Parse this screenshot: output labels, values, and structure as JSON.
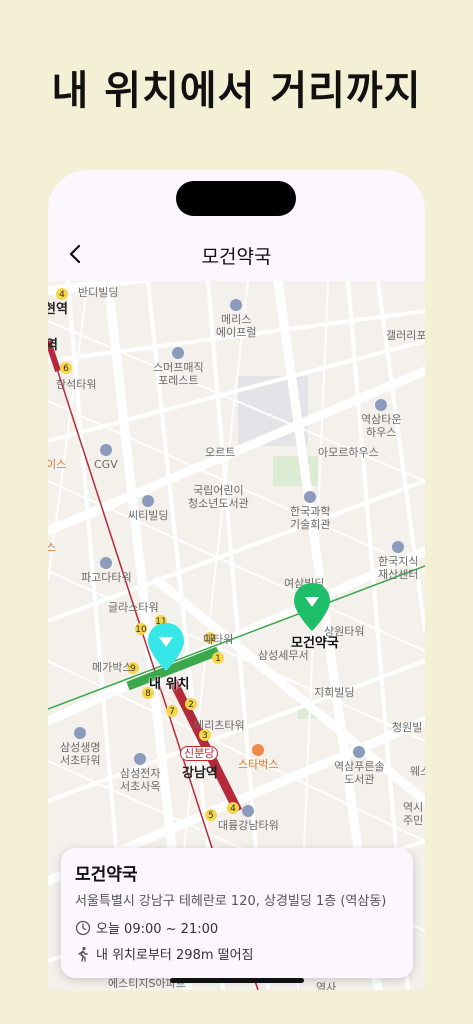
{
  "headline": "내 위치에서 거리까지",
  "nav": {
    "title": "모건약국",
    "back_icon": "chevron-left-icon"
  },
  "map": {
    "pois": [
      {
        "name": "반디빌딩"
      },
      {
        "name": "메리스\n에이프럴"
      },
      {
        "name": "갤러리포"
      },
      {
        "name": "현역"
      },
      {
        "name": "역"
      },
      {
        "name": "한석타워"
      },
      {
        "name": "스머프매직\n포레스트"
      },
      {
        "name": "역삼타운\n하우스"
      },
      {
        "name": "CGV"
      },
      {
        "name": "이스"
      },
      {
        "name": "오르트"
      },
      {
        "name": "아모르하우스"
      },
      {
        "name": "국립어린이\n청소년도서관"
      },
      {
        "name": "씨티빌딩"
      },
      {
        "name": "한국과학\n기술회관"
      },
      {
        "name": "스"
      },
      {
        "name": "파고다타워"
      },
      {
        "name": "한국지식\n재산센터"
      },
      {
        "name": "여삼빌딩"
      },
      {
        "name": "글라스타워"
      },
      {
        "name": "상원타워"
      },
      {
        "name": "메가박스"
      },
      {
        "name": "매타워"
      },
      {
        "name": "삼성세무서"
      },
      {
        "name": "지희빌딩"
      },
      {
        "name": "메리츠타워"
      },
      {
        "name": "삼성생명\n서초타워"
      },
      {
        "name": "신분당"
      },
      {
        "name": "스타벅스"
      },
      {
        "name": "청원빌"
      },
      {
        "name": "삼성전자\n서초사옥"
      },
      {
        "name": "강남역"
      },
      {
        "name": "역삼푸른솔\n도서관"
      },
      {
        "name": "웨스"
      },
      {
        "name": "대륭강남타워"
      },
      {
        "name": "역시\n주민"
      },
      {
        "name": "에스티지S아파트"
      },
      {
        "name": "역사"
      }
    ],
    "my_location_label": "내 위치",
    "destination_label": "모건약국",
    "station_numbers": [
      "4",
      "6",
      "10",
      "11",
      "12",
      "9",
      "8",
      "7",
      "2",
      "3",
      "1",
      "5",
      "4"
    ]
  },
  "card": {
    "title": "모건약국",
    "address": "서울특별시 강남구 테헤란로 120, 상경빌딩 1층 (역삼동)",
    "hours": "오늘 09:00 ~ 21:00",
    "distance": "내 위치로부터 298m 떨어짐",
    "clock_icon": "clock-icon",
    "walk_icon": "walking-person-icon"
  },
  "colors": {
    "background": "#f3f0d6",
    "my_location_pin": "#37e6e6",
    "destination_pin": "#1fbe6a",
    "line_green": "#3aa84b",
    "line_red": "#b52a3a"
  }
}
